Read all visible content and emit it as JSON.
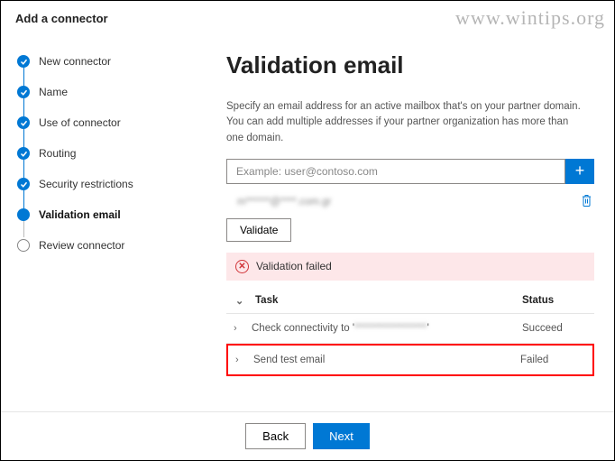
{
  "watermark": "www.wintips.org",
  "header": {
    "title": "Add a connector"
  },
  "sidebar": {
    "steps": [
      {
        "label": "New connector"
      },
      {
        "label": "Name"
      },
      {
        "label": "Use of connector"
      },
      {
        "label": "Routing"
      },
      {
        "label": "Security restrictions"
      },
      {
        "label": "Validation email"
      },
      {
        "label": "Review connector"
      }
    ]
  },
  "main": {
    "title": "Validation email",
    "description": "Specify an email address for an active mailbox that's on your partner domain. You can add multiple addresses if your partner organization has more than one domain.",
    "email_placeholder": "Example: user@contoso.com",
    "added_email": "m******@****.com.gr",
    "validate_label": "Validate",
    "fail_label": "Validation failed",
    "table": {
      "col_task": "Task",
      "col_status": "Status",
      "rows": [
        {
          "task_prefix": "Check connectivity to '",
          "task_blur": "******************",
          "task_suffix": "'",
          "status": "Succeed"
        },
        {
          "task_prefix": "Send test email",
          "task_blur": "",
          "task_suffix": "",
          "status": "Failed"
        }
      ]
    }
  },
  "footer": {
    "back": "Back",
    "next": "Next"
  }
}
